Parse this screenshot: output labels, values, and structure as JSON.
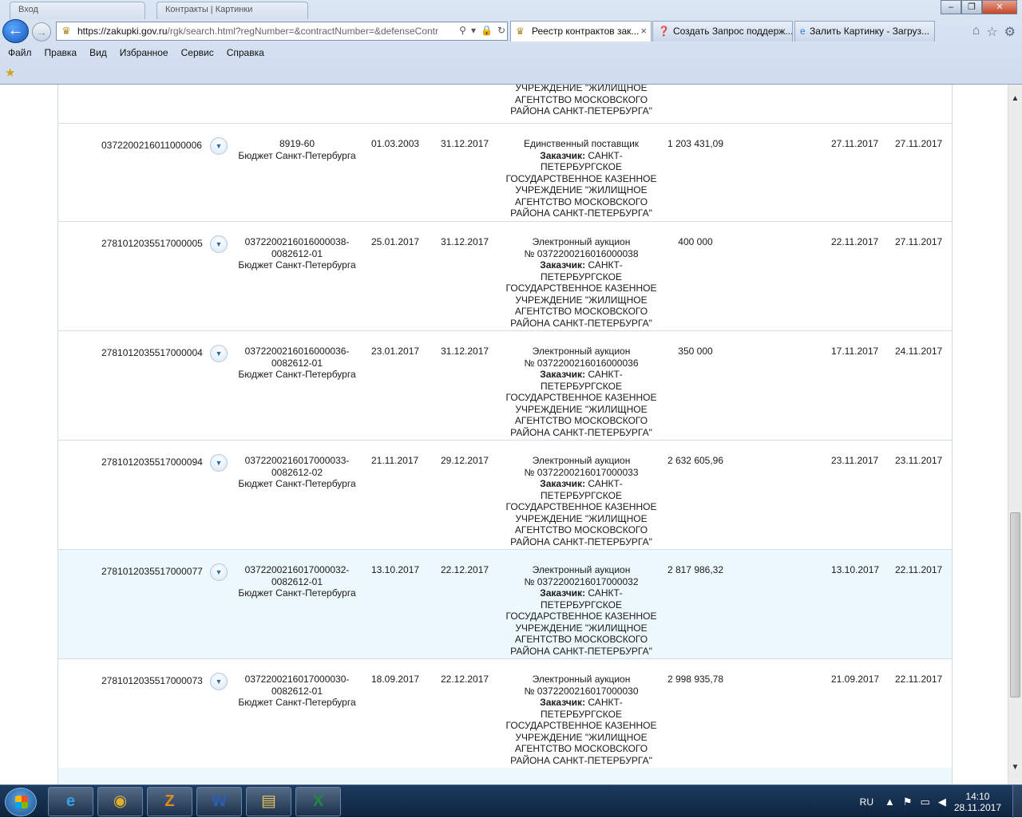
{
  "browser": {
    "bg_tabs": [
      "Вход",
      "Контракты | Картинки"
    ],
    "address": {
      "host": "https://zakupki.gov.ru",
      "rest": "/rgk/search.html?regNumber=&contractNumber=&defenseContr"
    },
    "tabs": [
      {
        "label": "Реестр контрактов зак...",
        "active": true
      },
      {
        "label": "Создать Запрос поддерж...",
        "active": false
      },
      {
        "label": "Залить Картинку - Загруз...",
        "active": false
      }
    ],
    "close_glyph": "×",
    "menu": [
      "Файл",
      "Правка",
      "Вид",
      "Избранное",
      "Сервис",
      "Справка"
    ]
  },
  "contracts": {
    "partial_top_row": {
      "purchase_lines": [
        "УЧРЕЖДЕНИЕ \"ЖИЛИЩНОЕ",
        "АГЕНТСТВО МОСКОВСКОГО",
        "РАЙОНА САНКТ-ПЕТЕРБУРГА\""
      ]
    },
    "customer_label": "Заказчик:",
    "rows": [
      {
        "reg_number": "0372200216011000006",
        "ident_lines": [
          "8919-60",
          "Бюджет Санкт-Петербурга"
        ],
        "date_conclusion": "01.03.2003",
        "date_end": "31.12.2017",
        "purchase_method": "Единственный поставщик",
        "purchase_number": "",
        "customer_first": "САНКТ-",
        "customer_lines": [
          "ПЕТЕРБУРГСКОЕ",
          "ГОСУДАРСТВЕННОЕ КАЗЕННОЕ",
          "УЧРЕЖДЕНИЕ \"ЖИЛИЩНОЕ",
          "АГЕНТСТВО МОСКОВСКОГО",
          "РАЙОНА САНКТ-ПЕТЕРБУРГА\""
        ],
        "price": "1 203 431,09",
        "date_published": "27.11.2017",
        "date_updated": "27.11.2017"
      },
      {
        "reg_number": "2781012035517000005",
        "ident_lines": [
          "0372200216016000038-",
          "0082612-01",
          "Бюджет Санкт-Петербурга"
        ],
        "date_conclusion": "25.01.2017",
        "date_end": "31.12.2017",
        "purchase_method": "Электронный аукцион",
        "purchase_number": "№ 0372200216016000038",
        "customer_first": "САНКТ-",
        "customer_lines": [
          "ПЕТЕРБУРГСКОЕ",
          "ГОСУДАРСТВЕННОЕ КАЗЕННОЕ",
          "УЧРЕЖДЕНИЕ \"ЖИЛИЩНОЕ",
          "АГЕНТСТВО МОСКОВСКОГО",
          "РАЙОНА САНКТ-ПЕТЕРБУРГА\""
        ],
        "price": "400 000",
        "date_published": "22.11.2017",
        "date_updated": "27.11.2017"
      },
      {
        "reg_number": "2781012035517000004",
        "ident_lines": [
          "0372200216016000036-",
          "0082612-01",
          "Бюджет Санкт-Петербурга"
        ],
        "date_conclusion": "23.01.2017",
        "date_end": "31.12.2017",
        "purchase_method": "Электронный аукцион",
        "purchase_number": "№ 0372200216016000036",
        "customer_first": "САНКТ-",
        "customer_lines": [
          "ПЕТЕРБУРГСКОЕ",
          "ГОСУДАРСТВЕННОЕ КАЗЕННОЕ",
          "УЧРЕЖДЕНИЕ \"ЖИЛИЩНОЕ",
          "АГЕНТСТВО МОСКОВСКОГО",
          "РАЙОНА САНКТ-ПЕТЕРБУРГА\""
        ],
        "price": "350 000",
        "date_published": "17.11.2017",
        "date_updated": "24.11.2017"
      },
      {
        "reg_number": "2781012035517000094",
        "ident_lines": [
          "0372200216017000033-",
          "0082612-02",
          "Бюджет Санкт-Петербурга"
        ],
        "date_conclusion": "21.11.2017",
        "date_end": "29.12.2017",
        "purchase_method": "Электронный аукцион",
        "purchase_number": "№ 0372200216017000033",
        "customer_first": "САНКТ-",
        "customer_lines": [
          "ПЕТЕРБУРГСКОЕ",
          "ГОСУДАРСТВЕННОЕ КАЗЕННОЕ",
          "УЧРЕЖДЕНИЕ \"ЖИЛИЩНОЕ",
          "АГЕНТСТВО МОСКОВСКОГО",
          "РАЙОНА САНКТ-ПЕТЕРБУРГА\""
        ],
        "price": "2 632 605,96",
        "date_published": "23.11.2017",
        "date_updated": "23.11.2017"
      },
      {
        "reg_number": "2781012035517000077",
        "ident_lines": [
          "0372200216017000032-",
          "0082612-01",
          "Бюджет Санкт-Петербурга"
        ],
        "date_conclusion": "13.10.2017",
        "date_end": "22.12.2017",
        "purchase_method": "Электронный аукцион",
        "purchase_number": "№ 0372200216017000032",
        "customer_first": "САНКТ-",
        "customer_lines": [
          "ПЕТЕРБУРГСКОЕ",
          "ГОСУДАРСТВЕННОЕ КАЗЕННОЕ",
          "УЧРЕЖДЕНИЕ \"ЖИЛИЩНОЕ",
          "АГЕНТСТВО МОСКОВСКОГО",
          "РАЙОНА САНКТ-ПЕТЕРБУРГА\""
        ],
        "price": "2 817 986,32",
        "date_published": "13.10.2017",
        "date_updated": "22.11.2017"
      },
      {
        "reg_number": "2781012035517000073",
        "ident_lines": [
          "0372200216017000030-",
          "0082612-01",
          "Бюджет Санкт-Петербурга"
        ],
        "date_conclusion": "18.09.2017",
        "date_end": "22.12.2017",
        "purchase_method": "Электронный аукцион",
        "purchase_number": "№ 0372200216017000030",
        "customer_first": "САНКТ-",
        "customer_lines": [
          "ПЕТЕРБУРГСКОЕ",
          "ГОСУДАРСТВЕННОЕ КАЗЕННОЕ",
          "УЧРЕЖДЕНИЕ \"ЖИЛИЩНОЕ",
          "АГЕНТСТВО МОСКОВСКОГО",
          "РАЙОНА САНКТ-ПЕТЕРБУРГА\""
        ],
        "price": "2 998 935,78",
        "date_published": "21.09.2017",
        "date_updated": "22.11.2017"
      }
    ]
  },
  "taskbar": {
    "apps": [
      {
        "icon": "internet-explorer-icon",
        "glyph": "e",
        "color": "#3aa0e8"
      },
      {
        "icon": "chrome-icon",
        "glyph": "◉",
        "color": "#e0b030"
      },
      {
        "icon": "app-z-icon",
        "glyph": "Z",
        "color": "#e08a1a"
      },
      {
        "icon": "word-icon",
        "glyph": "W",
        "color": "#2b5fb4"
      },
      {
        "icon": "file-explorer-icon",
        "glyph": "▤",
        "color": "#e8c35a"
      },
      {
        "icon": "excel-icon",
        "glyph": "X",
        "color": "#1f8a3c"
      }
    ],
    "language": "RU",
    "time": "14:10",
    "date": "28.11.2017"
  }
}
